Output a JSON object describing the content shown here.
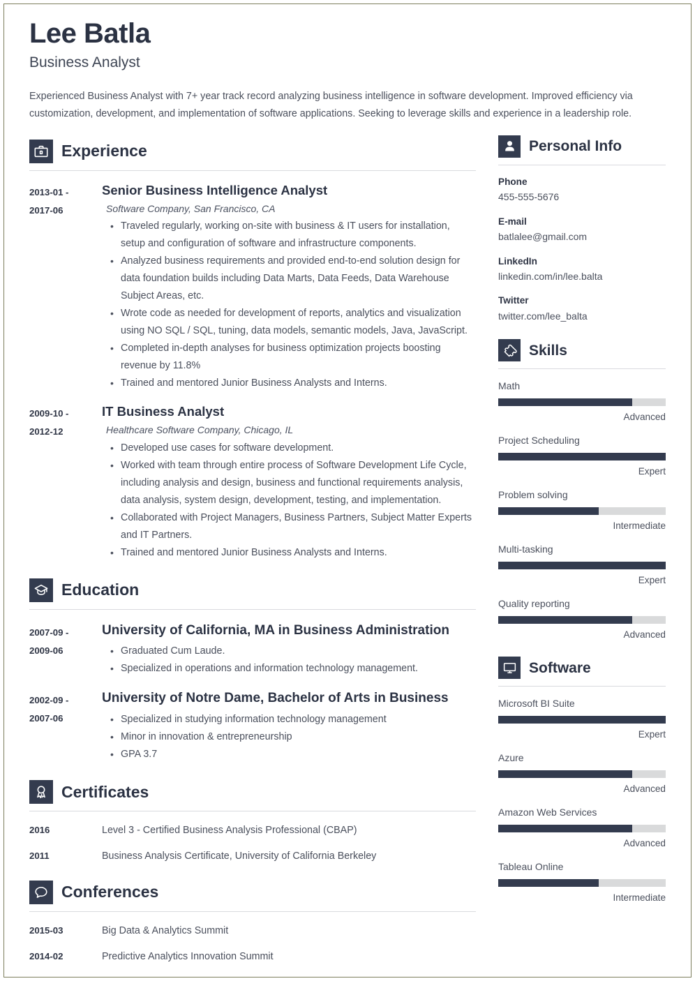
{
  "header": {
    "name": "Lee Batla",
    "job_title": "Business Analyst",
    "summary": "Experienced Business Analyst with 7+ year track record analyzing business intelligence in software development. Improved efficiency via customization, development, and implementation of software applications. Seeking to leverage skills and experience in a leadership role."
  },
  "colors": {
    "accent_dark": "#333b4e",
    "heading": "#2b3243",
    "body_text": "#4a4f5c",
    "bar_track": "#d9dadb",
    "rule": "#d9dade",
    "page_border": "#7d7f5e"
  },
  "experience": {
    "title": "Experience",
    "icon": "briefcase-icon",
    "entries": [
      {
        "date_start": "2013-01 -",
        "date_end": "2017-06",
        "heading": "Senior Business Intelligence Analyst",
        "subheading": "Software Company, San Francisco, CA",
        "bullets": [
          "Traveled regularly, working on-site with business & IT users for installation, setup and configuration of software and infrastructure components.",
          "Analyzed business requirements and provided end-to-end solution design for data foundation builds including Data Marts, Data Feeds, Data Warehouse Subject Areas, etc.",
          "Wrote code as needed for development of reports, analytics and visualization using NO SQL / SQL, tuning, data models, semantic models, Java, JavaScript.",
          "Completed in-depth analyses for business optimization projects boosting revenue by 11.8%",
          "Trained and mentored Junior Business Analysts and Interns."
        ]
      },
      {
        "date_start": "2009-10 -",
        "date_end": "2012-12",
        "heading": "IT Business Analyst",
        "subheading": "Healthcare Software Company, Chicago, IL",
        "bullets": [
          "Developed use cases for software development.",
          "Worked with team through entire process of Software Development Life Cycle, including analysis and design, business and functional requirements analysis, data analysis, system design, development, testing, and implementation.",
          "Collaborated with Project Managers, Business Partners, Subject Matter Experts and IT Partners.",
          "Trained and mentored Junior Business Analysts and Interns."
        ]
      }
    ]
  },
  "education": {
    "title": "Education",
    "icon": "graduation-cap-icon",
    "entries": [
      {
        "date_start": "2007-09 -",
        "date_end": "2009-06",
        "heading": "University of California, MA in Business Administration",
        "bullets": [
          "Graduated Cum Laude.",
          "Specialized in operations and information technology management."
        ]
      },
      {
        "date_start": "2002-09 -",
        "date_end": "2007-06",
        "heading": "University of Notre Dame, Bachelor of Arts in Business",
        "bullets": [
          "Specialized in studying information technology management",
          "Minor in innovation & entrepreneurship",
          "GPA 3.7"
        ]
      }
    ]
  },
  "certificates": {
    "title": "Certificates",
    "icon": "award-ribbon-icon",
    "rows": [
      {
        "date": "2016",
        "text": "Level 3 - Certified Business Analysis Professional (CBAP)"
      },
      {
        "date": "2011",
        "text": "Business Analysis Certificate, University of California Berkeley"
      }
    ]
  },
  "conferences": {
    "title": "Conferences",
    "icon": "speech-bubble-icon",
    "rows": [
      {
        "date": "2015-03",
        "text": "Big Data & Analytics Summit"
      },
      {
        "date": "2014-02",
        "text": "Predictive Analytics Innovation Summit"
      }
    ]
  },
  "personal_info": {
    "title": "Personal Info",
    "icon": "person-icon",
    "items": [
      {
        "label": "Phone",
        "value": "455-555-5676"
      },
      {
        "label": "E-mail",
        "value": "batlalee@gmail.com"
      },
      {
        "label": "LinkedIn",
        "value": "linkedin.com/in/lee.balta"
      },
      {
        "label": "Twitter",
        "value": "twitter.com/lee_balta"
      }
    ]
  },
  "skills": {
    "title": "Skills",
    "icon": "puzzle-piece-icon",
    "items": [
      {
        "name": "Math",
        "level": "Advanced",
        "percent": 80
      },
      {
        "name": "Project Scheduling",
        "level": "Expert",
        "percent": 100
      },
      {
        "name": "Problem solving",
        "level": "Intermediate",
        "percent": 60
      },
      {
        "name": "Multi-tasking",
        "level": "Expert",
        "percent": 100
      },
      {
        "name": "Quality reporting",
        "level": "Advanced",
        "percent": 80
      }
    ]
  },
  "software": {
    "title": "Software",
    "icon": "monitor-icon",
    "items": [
      {
        "name": "Microsoft BI Suite",
        "level": "Expert",
        "percent": 100
      },
      {
        "name": "Azure",
        "level": "Advanced",
        "percent": 80
      },
      {
        "name": "Amazon Web Services",
        "level": "Advanced",
        "percent": 80
      },
      {
        "name": "Tableau Online",
        "level": "Intermediate",
        "percent": 60
      }
    ]
  }
}
